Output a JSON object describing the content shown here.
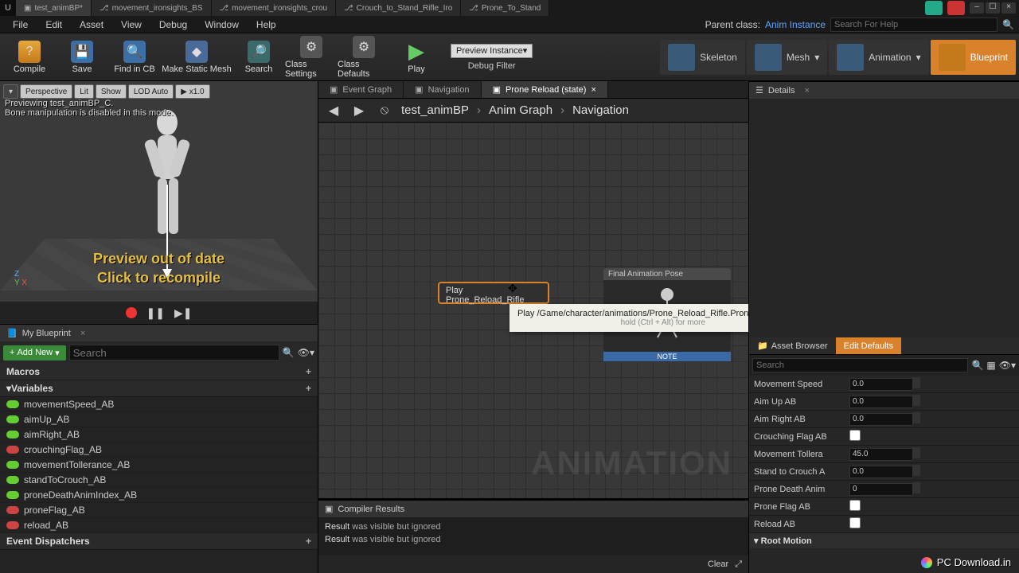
{
  "titlebar": {
    "tabs": [
      {
        "label": "test_animBP*",
        "icon": "bp"
      },
      {
        "label": "movement_ironsights_BS",
        "icon": "anim"
      },
      {
        "label": "movement_ironsights_crou",
        "icon": "anim"
      },
      {
        "label": "Crouch_to_Stand_Rifle_Iro",
        "icon": "anim"
      },
      {
        "label": "Prone_To_Stand",
        "icon": "anim"
      }
    ]
  },
  "menubar": {
    "items": [
      "File",
      "Edit",
      "Asset",
      "View",
      "Debug",
      "Window",
      "Help"
    ],
    "parent_class_label": "Parent class:",
    "parent_class": "Anim Instance",
    "help_placeholder": "Search For Help"
  },
  "toolbar": {
    "compile": "Compile",
    "save": "Save",
    "find": "Find in CB",
    "mesh": "Make Static Mesh",
    "search": "Search",
    "settings": "Class Settings",
    "defaults": "Class Defaults",
    "play": "Play",
    "debug_dropdown": "Preview Instance▾",
    "debug_label": "Debug Filter",
    "modes": {
      "skeleton": "Skeleton",
      "mesh": "Mesh",
      "animation": "Animation",
      "blueprint": "Blueprint"
    }
  },
  "viewport": {
    "buttons": {
      "menu": "▾",
      "perspective": "Perspective",
      "lit": "Lit",
      "show": "Show",
      "lod": "LOD Auto",
      "speed": "▶ x1.0"
    },
    "msg": "Previewing test_animBP_C.\nBone manipulation is disabled in this mode.",
    "warn": "Preview out of date\nClick to recompile",
    "axis": {
      "z": "Z",
      "y": "Y",
      "x": "X"
    }
  },
  "myblueprint": {
    "title": "My Blueprint",
    "add_new": "Add New",
    "search_placeholder": "Search",
    "categories": {
      "macros": "Macros",
      "variables": "Variables",
      "dispatchers": "Event Dispatchers"
    },
    "vars": [
      {
        "name": "movementSpeed_AB",
        "color": "green"
      },
      {
        "name": "aimUp_AB",
        "color": "green"
      },
      {
        "name": "aimRight_AB",
        "color": "green"
      },
      {
        "name": "crouchingFlag_AB",
        "color": "red"
      },
      {
        "name": "movementTollerance_AB",
        "color": "green"
      },
      {
        "name": "standToCrouch_AB",
        "color": "green"
      },
      {
        "name": "proneDeathAnimIndex_AB",
        "color": "green"
      },
      {
        "name": "proneFlag_AB",
        "color": "red"
      },
      {
        "name": "reload_AB",
        "color": "red"
      }
    ]
  },
  "graph_tabs": [
    {
      "label": "Event Graph"
    },
    {
      "label": "Navigation"
    },
    {
      "label": "Prone Reload (state)",
      "active": true
    }
  ],
  "breadcrumb": {
    "items": [
      "test_animBP",
      "Anim Graph",
      "Navigation"
    ]
  },
  "graph": {
    "watermark": "ANIMATION",
    "play_node": "Play Prone_Reload_Rifle",
    "final_node": "Final Animation Pose",
    "note": "NOTE",
    "tooltip": "Play /Game/character/animations/Prone_Reload_Rifle.Prone_Reload_Rifle",
    "tooltip_sub": "hold (Ctrl + Alt) for more"
  },
  "compiler": {
    "title": "Compiler Results",
    "rows": [
      {
        "r": "Result",
        "msg": " was visible but ignored"
      },
      {
        "r": "Result",
        "msg": " was visible but ignored"
      }
    ],
    "clear": "Clear"
  },
  "details": {
    "tab": "Details",
    "asset_browser_tab": "Asset Browser",
    "defaults_tab": "Edit Defaults",
    "search_placeholder": "Search",
    "props": [
      {
        "label": "Movement Speed",
        "val": "0.0",
        "type": "num"
      },
      {
        "label": "Aim Up AB",
        "val": "0.0",
        "type": "num"
      },
      {
        "label": "Aim Right AB",
        "val": "0.0",
        "type": "num"
      },
      {
        "label": "Crouching Flag AB",
        "val": "",
        "type": "bool"
      },
      {
        "label": "Movement Tollera",
        "val": "45.0",
        "type": "num"
      },
      {
        "label": "Stand to Crouch A",
        "val": "0.0",
        "type": "num"
      },
      {
        "label": "Prone Death Anim",
        "val": "0",
        "type": "num"
      },
      {
        "label": "Prone Flag AB",
        "val": "",
        "type": "bool"
      },
      {
        "label": "Reload AB",
        "val": "",
        "type": "bool"
      }
    ],
    "section": "Root Motion"
  },
  "watermark_dl": "PC Download.in"
}
